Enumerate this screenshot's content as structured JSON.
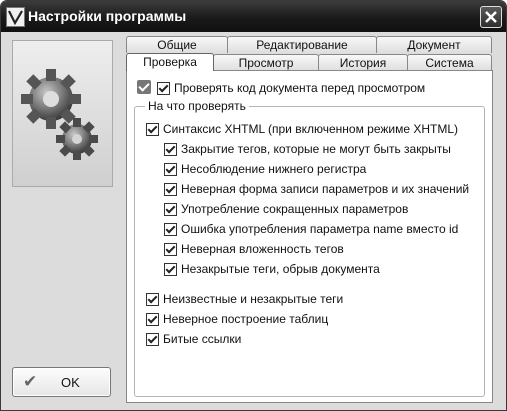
{
  "window": {
    "title": "Настройки программы"
  },
  "tabs_row1": [
    "Общие",
    "Редактирование",
    "Документ"
  ],
  "tabs_row2": [
    "Проверка",
    "Просмотр",
    "История",
    "Система"
  ],
  "check_before_view": "Проверять код документа перед просмотром",
  "group_title": "На что проверять",
  "xhtml_syntax": "Синтаксис XHTML (при включенном режиме XHTML)",
  "xhtml_subitems": [
    "Закрытие тегов, которые не могут быть закрыты",
    "Несоблюдение нижнего регистра",
    "Неверная форма записи параметров и их значений",
    "Употребление сокращенных параметров",
    "Ошибка употребления параметра name вместо id",
    "Неверная вложенность тегов",
    "Незакрытые теги, обрыв документа"
  ],
  "other_items": [
    "Неизвестные и незакрытые теги",
    "Неверное построение таблиц",
    "Битые ссылки"
  ],
  "ok_label": "OK"
}
